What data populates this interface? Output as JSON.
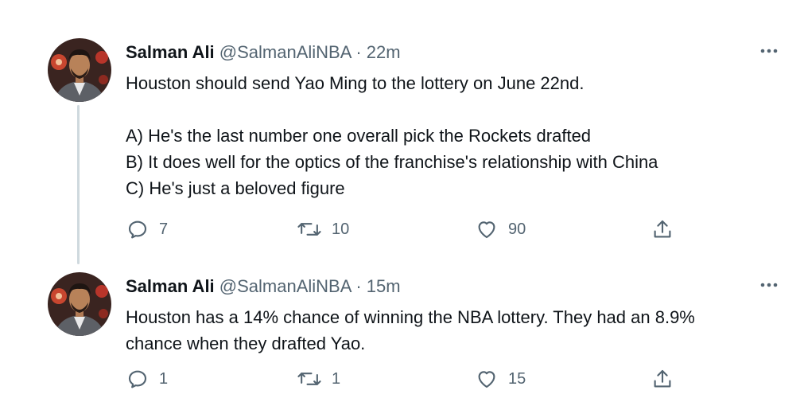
{
  "tweets": [
    {
      "author_name": "Salman Ali",
      "handle": "@SalmanAliNBA",
      "separator": "·",
      "time": "22m",
      "text_lines": [
        "Houston should send Yao Ming to the lottery on June 22nd.",
        "",
        "A) He's the last number one overall pick the Rockets drafted",
        "B) It does well for the optics of the franchise's relationship with China",
        "C) He's just a beloved figure"
      ],
      "replies": "7",
      "retweets": "10",
      "likes": "90"
    },
    {
      "author_name": "Salman Ali",
      "handle": "@SalmanAliNBA",
      "separator": "·",
      "time": "15m",
      "text_lines": [
        "Houston has a 14% chance of winning the NBA lottery. They had an 8.9%",
        "chance when they drafted Yao."
      ],
      "replies": "1",
      "retweets": "1",
      "likes": "15"
    }
  ],
  "icons": {
    "reply": "reply-icon",
    "retweet": "retweet-icon",
    "like": "heart-icon",
    "share": "share-icon",
    "more": "more-icon"
  },
  "colors": {
    "text": "#0f1419",
    "secondary": "#536471",
    "thread_line": "#cfd9de"
  }
}
